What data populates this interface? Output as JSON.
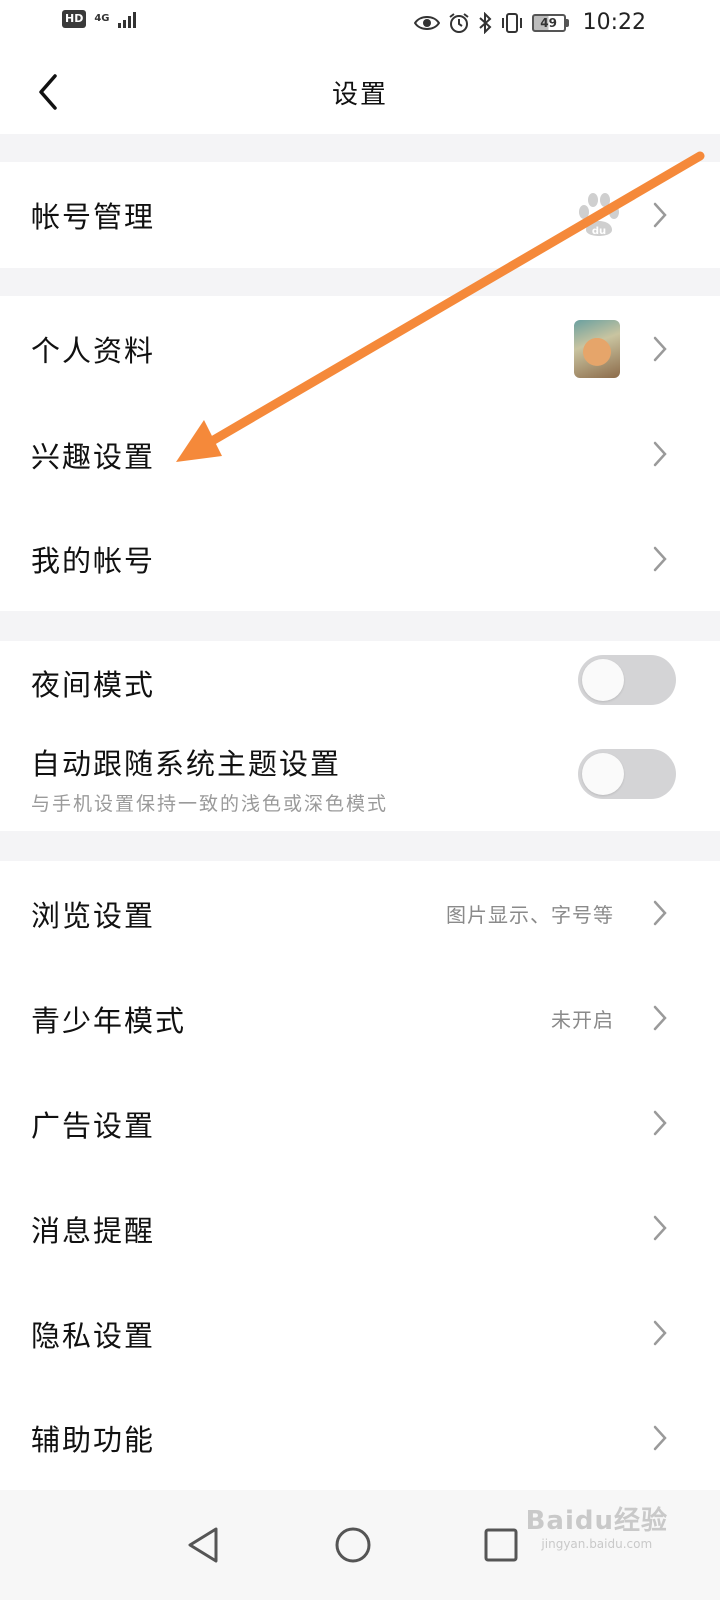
{
  "status_bar": {
    "hd": "HD",
    "network": "4G",
    "battery": "49",
    "time": "10:22"
  },
  "header": {
    "title": "设置"
  },
  "sections": {
    "account": {
      "label": "帐号管理",
      "icon": "baidu-paw-icon"
    },
    "profile": {
      "label": "个人资料",
      "icon": "avatar-cat"
    },
    "interest": {
      "label": "兴趣设置"
    },
    "my_account": {
      "label": "我的帐号"
    },
    "night_mode": {
      "label": "夜间模式",
      "enabled": false
    },
    "follow_system": {
      "label": "自动跟随系统主题设置",
      "sublabel": "与手机设置保持一致的浅色或深色模式",
      "enabled": false
    },
    "browse": {
      "label": "浏览设置",
      "value": "图片显示、字号等"
    },
    "youth": {
      "label": "青少年模式",
      "value": "未开启"
    },
    "ads": {
      "label": "广告设置"
    },
    "messages": {
      "label": "消息提醒"
    },
    "privacy": {
      "label": "隐私设置"
    },
    "accessibility": {
      "label": "辅助功能"
    }
  },
  "watermark": {
    "main": "Baidu经验",
    "sub": "jingyan.baidu.com"
  },
  "colors": {
    "annotation_arrow": "#f5893a",
    "divider": "#f4f4f6",
    "toggle_off": "#d4d4d6"
  }
}
